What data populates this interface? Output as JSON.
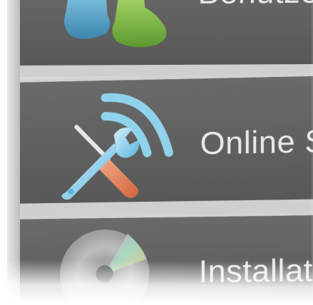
{
  "tiles": [
    {
      "label": "Benutze",
      "icon": "users-icon"
    },
    {
      "label": "Online S",
      "icon": "wrench-screwdriver-wifi-icon"
    },
    {
      "label": "Installati",
      "icon": "disc-icon"
    }
  ],
  "colors": {
    "tile_bg": "#5f5f5f",
    "divider": "#d2d2d2",
    "label_text": "#e9e9e9",
    "signal_blue": "#8fd2ec",
    "wrench_blue": "#6cc0e4",
    "handle_orange": "#e8845a"
  }
}
